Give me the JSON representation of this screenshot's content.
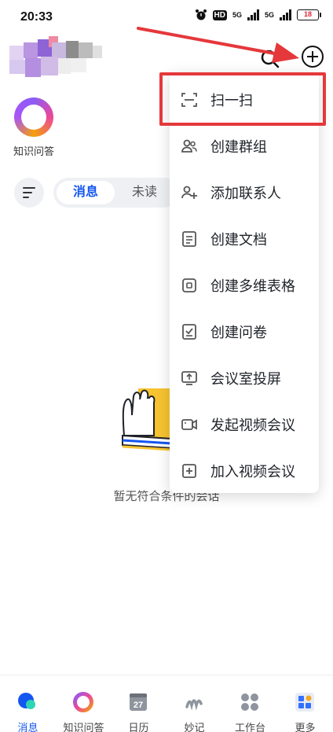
{
  "status_bar": {
    "time": "20:33",
    "hd_label": "HD",
    "signal_1": "5G",
    "signal_2": "5G",
    "battery": "18"
  },
  "header": {
    "search_icon": "search-icon",
    "add_icon": "plus-circle-icon"
  },
  "quick_access": {
    "label": "知识问答"
  },
  "filter": {
    "active_tab": "消息",
    "other_tab": "未读"
  },
  "empty_state": {
    "text": "暂无符合条件的会话"
  },
  "dropdown_menu": {
    "items": [
      {
        "label": "扫一扫",
        "icon": "scan-icon"
      },
      {
        "label": "创建群组",
        "icon": "group-icon"
      },
      {
        "label": "添加联系人",
        "icon": "add-contact-icon"
      },
      {
        "label": "创建文档",
        "icon": "document-icon"
      },
      {
        "label": "创建多维表格",
        "icon": "base-table-icon"
      },
      {
        "label": "创建问卷",
        "icon": "survey-icon"
      },
      {
        "label": "会议室投屏",
        "icon": "screen-cast-icon"
      },
      {
        "label": "发起视频会议",
        "icon": "video-icon"
      },
      {
        "label": "加入视频会议",
        "icon": "join-meeting-icon"
      }
    ]
  },
  "tab_bar": {
    "items": [
      {
        "label": "消息",
        "icon": "message-icon"
      },
      {
        "label": "知识问答",
        "icon": "qa-ring-icon"
      },
      {
        "label": "日历",
        "icon": "calendar-icon",
        "day": "27"
      },
      {
        "label": "妙记",
        "icon": "minutes-icon"
      },
      {
        "label": "工作台",
        "icon": "workplace-icon"
      },
      {
        "label": "更多",
        "icon": "more-apps-icon"
      }
    ]
  },
  "colors": {
    "accent": "#1456f0",
    "highlight": "#e5383b"
  }
}
